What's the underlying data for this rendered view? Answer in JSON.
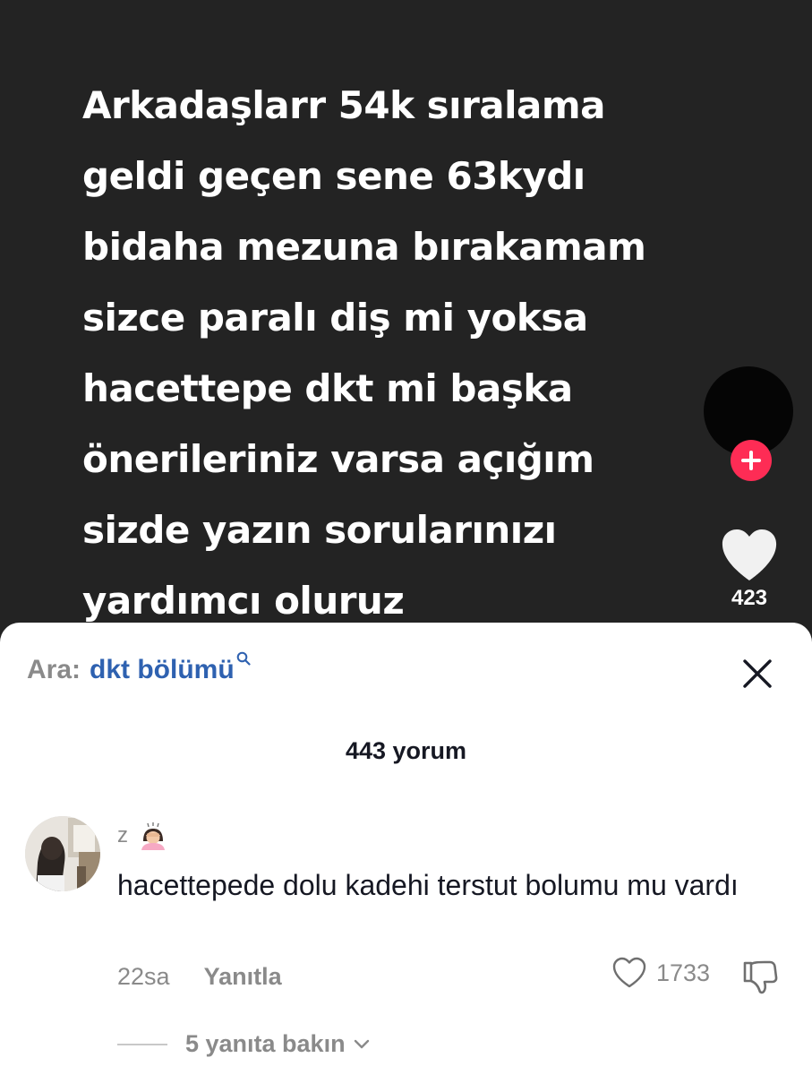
{
  "video": {
    "caption_lines": [
      "Arkadaşlarr 54k sıralama",
      "geldi geçen sene 63kydı",
      "bidaha mezuna bırakamam",
      "sizce paralı diş mi yoksa",
      "hacettepe dkt mi başka",
      "önerileriniz varsa açığım",
      "sizde yazın sorularınızı",
      "yardımcı oluruz"
    ],
    "like_count": "423",
    "icons": {
      "follow": "plus-icon",
      "like": "heart-icon"
    },
    "colors": {
      "background": "#232323",
      "follow_accent": "#fe2c55"
    }
  },
  "comments": {
    "search_label": "Ara:",
    "search_term": "dkt bölümü",
    "count_label": "443 yorum",
    "items": [
      {
        "username": "z",
        "text": "hacettepede dolu kadehi terstut bolumu mu vardı",
        "time": "22sa",
        "reply_label": "Yanıtla",
        "likes": "1733",
        "view_replies": "5 yanıta bakın"
      }
    ],
    "icons": {
      "search": "search-icon",
      "close": "close-icon",
      "like": "heart-outline-icon",
      "dislike": "thumbs-down-icon",
      "expand": "chevron-down-icon"
    },
    "colors": {
      "search_term": "#2e61b0",
      "muted": "#8a8a8a"
    }
  }
}
